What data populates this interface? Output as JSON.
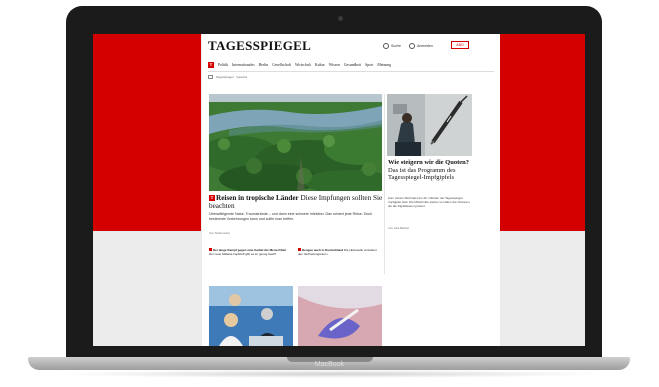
{
  "device": {
    "brand": "MacBook"
  },
  "site": {
    "logo": "TAGESSPIEGEL",
    "search_label": "Suche",
    "login_label": "Anmelden",
    "abo_label": "ABO",
    "nav_badge": "T",
    "nav": [
      "Politik",
      "Internationales",
      "Berlin",
      "Gesellschaft",
      "Wirtschaft",
      "Kultur",
      "Wissen",
      "Gesundheit",
      "Sport",
      "Meinung"
    ],
    "breadcrumb": [
      "Tagesspiegel",
      "Gesund"
    ]
  },
  "hero": {
    "badge": "T",
    "title_bold": "Reisen in tropische Länder",
    "title_rest": "Diese Impfungen sollten Sie beachten",
    "teaser": "Überwältigende Natur, Traumstrände – und dann eine schwere Infektion: Das ruiniert jede Reise. Doch bestimmte Vorkehrungen kann und sollte man treffen.",
    "author": "Von Stella Huber"
  },
  "links": [
    {
      "bold": "Der lange Kampf gegen eine Geißel der Menschheit",
      "rest": "Der neue Malaria-Impfstoff gibt es im genug Geld?"
    },
    {
      "bold": "Dengue auch in Deutschland",
      "rest": "Die Hitzewelle verändert den Verbreitungsraum"
    }
  ],
  "side": {
    "title_bold": "Wie steigern wir die Quoten?",
    "title_rest": "Das ist das Programm des Tagesspiegel-Impfgipfels",
    "text": "Zum vierten Mal findet am 26. Oktober der Tagesspiegel Impfgipfel statt. Die Mitschnitte stehen vor allem die Chancen, die die Digitalisierung bietet.",
    "author": "Von Julia Barbell"
  },
  "colors": {
    "brand_red": "#d40000",
    "forest_green": "#2f6a2a",
    "river": "#7ea4b8"
  }
}
